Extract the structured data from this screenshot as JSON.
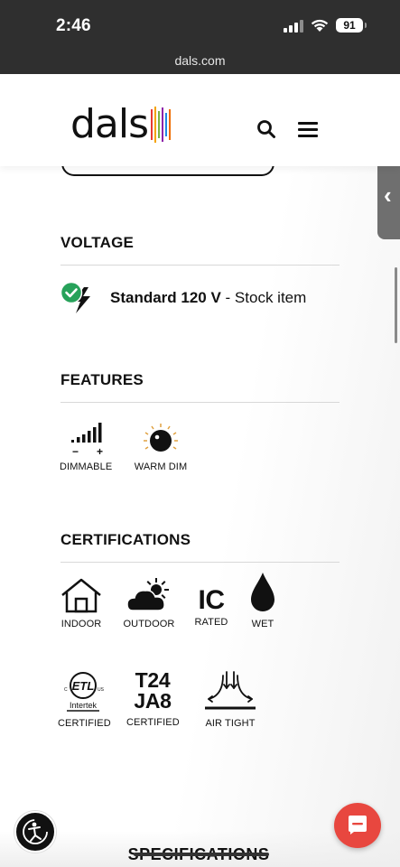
{
  "status_bar": {
    "time": "2:46",
    "battery": "91"
  },
  "browser": {
    "url": "dals.com"
  },
  "header": {
    "logo": "dals",
    "logo_bar_colors": [
      "#e53935",
      "#f4a300",
      "#7cb342",
      "#8e24aa",
      "#1e88e5",
      "#ef6c00"
    ]
  },
  "voltage": {
    "title": "VOLTAGE",
    "value_bold": "Standard 120 V",
    "value_rest": " - Stock item",
    "check_color": "#27a25a"
  },
  "features": {
    "title": "FEATURES",
    "items": [
      {
        "label": "DIMMABLE",
        "icon": "dimmer-bars-icon"
      },
      {
        "label": "WARM DIM",
        "icon": "warm-dim-icon"
      }
    ]
  },
  "certifications": {
    "title": "CERTIFICATIONS",
    "row1": [
      {
        "label": "INDOOR",
        "icon": "house-icon"
      },
      {
        "label": "OUTDOOR",
        "icon": "sun-cloud-icon"
      },
      {
        "label": "RATED",
        "icon_text": "IC"
      },
      {
        "label": "WET",
        "icon": "water-drop-icon"
      }
    ],
    "row2": [
      {
        "label": "CERTIFIED",
        "icon": "etl-intertek-icon",
        "icon_text": "Intertek"
      },
      {
        "label": "CERTIFIED",
        "icon_text_1": "T24",
        "icon_text_2": "JA8"
      },
      {
        "label": "AIR TIGHT",
        "icon": "air-tight-icon"
      }
    ]
  },
  "footer": {
    "specs_label": "SPECIFICATIONS"
  }
}
